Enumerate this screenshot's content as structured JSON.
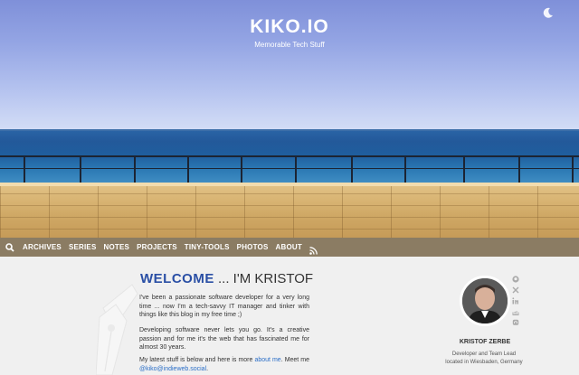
{
  "site": {
    "title": "KIKO.IO",
    "subtitle": "Memorable Tech Stuff"
  },
  "nav": {
    "items": [
      {
        "label": "ARCHIVES"
      },
      {
        "label": "SERIES"
      },
      {
        "label": "NOTES"
      },
      {
        "label": "PROJECTS"
      },
      {
        "label": "TINY-TOOLS"
      },
      {
        "label": "PHOTOS"
      },
      {
        "label": "ABOUT"
      }
    ],
    "icons": [
      "search-icon",
      "rss-icon"
    ]
  },
  "main": {
    "welcome_bold": "WELCOME",
    "welcome_rest": " ... I'M KRISTOF",
    "para1": "I've been a passionate software developer for a very long time ... now I'm a tech-savvy IT manager and tinker with things like this blog in my free time ;)",
    "para2": "Developing software never lets you go. It's a creative passion and for me it's the web that has fascinated me for almost 30 years.",
    "para3_prefix": "My latest stuff is below and here is more ",
    "para3_link": "about me",
    "para3_mid": ". Meet me",
    "para3_link2": "@kiko@indieweb.social",
    "para3_suffix": "."
  },
  "profile": {
    "name": "KRISTOF ZERBE",
    "role": "Developer and Team Lead",
    "location": "located in Wiesbaden, Germany",
    "social_icons": [
      "github-icon",
      "x-icon",
      "linkedin-icon",
      "stackoverflow-icon",
      "mastodon-icon"
    ]
  },
  "colors": {
    "nav_bg": "#8b7c63",
    "accent": "#2a4fa5",
    "link": "#2a6ec7"
  }
}
